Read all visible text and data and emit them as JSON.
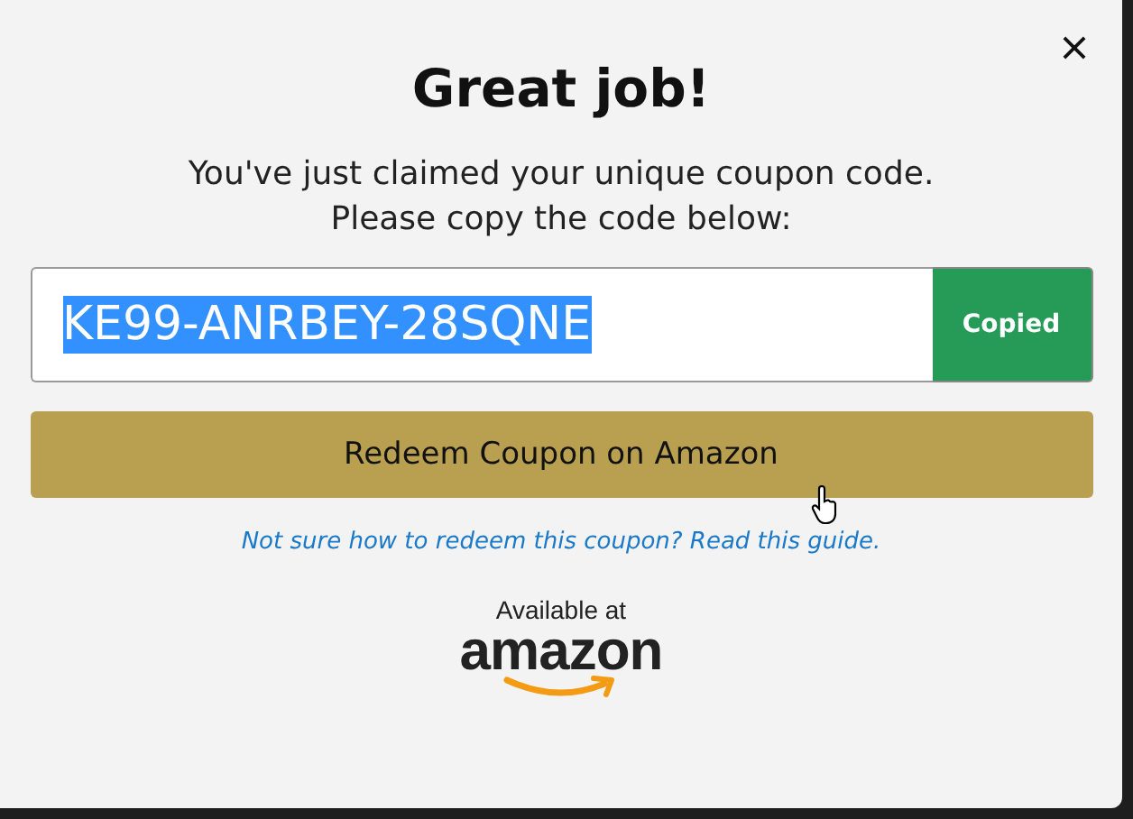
{
  "dialog": {
    "title": "Great job!",
    "message_lines": [
      "You've just claimed your unique coupon code.",
      "Please copy the code below:"
    ]
  },
  "coupon": {
    "code": "KE99-ANRBEY-28SQNE",
    "selected": true,
    "copy_button": "Copied",
    "copied": true
  },
  "redeem_button": "Redeem Coupon on Amazon",
  "help_link": "Not sure how to redeem this coupon? Read this guide.",
  "badge": {
    "caption": "Available at",
    "brand": "amazon"
  }
}
